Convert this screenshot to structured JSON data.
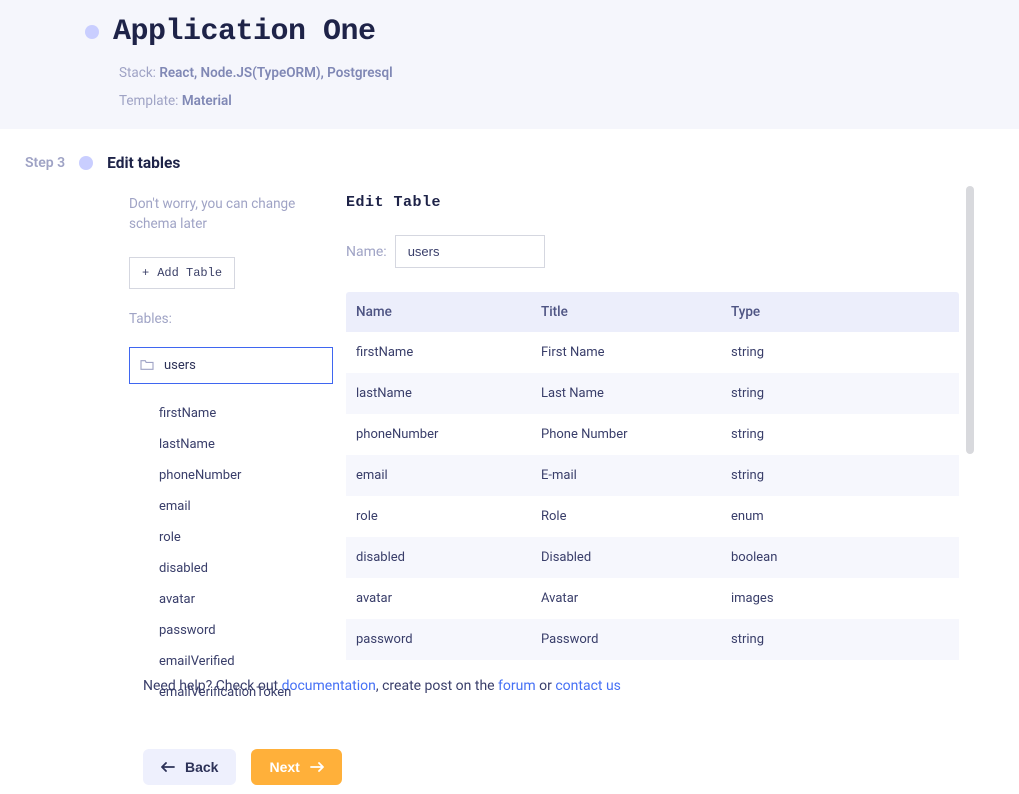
{
  "header": {
    "title": "Application One",
    "stack_label": "Stack:",
    "stack_value": "React, Node.JS(TypeORM), Postgresql",
    "template_label": "Template:",
    "template_value": "Material"
  },
  "step": {
    "label": "Step 3",
    "title": "Edit tables"
  },
  "left": {
    "hint": "Don't worry, you can change schema later",
    "add_table": "Add Table",
    "tables_label": "Tables:",
    "selected_table": "users",
    "fields": [
      "firstName",
      "lastName",
      "phoneNumber",
      "email",
      "role",
      "disabled",
      "avatar",
      "password",
      "emailVerified",
      "emailVerificationToken"
    ]
  },
  "right": {
    "title": "Edit Table",
    "name_label": "Name:",
    "name_value": "users",
    "columns": {
      "name": "Name",
      "title": "Title",
      "type": "Type"
    },
    "rows": [
      {
        "name": "firstName",
        "title": "First Name",
        "type": "string"
      },
      {
        "name": "lastName",
        "title": "Last Name",
        "type": "string"
      },
      {
        "name": "phoneNumber",
        "title": "Phone Number",
        "type": "string"
      },
      {
        "name": "email",
        "title": "E-mail",
        "type": "string"
      },
      {
        "name": "role",
        "title": "Role",
        "type": "enum"
      },
      {
        "name": "disabled",
        "title": "Disabled",
        "type": "boolean"
      },
      {
        "name": "avatar",
        "title": "Avatar",
        "type": "images"
      },
      {
        "name": "password",
        "title": "Password",
        "type": "string"
      }
    ]
  },
  "footer": {
    "help_prefix": "Need help? Check out ",
    "doc_link": "documentation",
    "help_mid1": ", create post on the ",
    "forum_link": "forum",
    "help_mid2": " or ",
    "contact_link": "contact us",
    "back": "Back",
    "next": "Next"
  }
}
